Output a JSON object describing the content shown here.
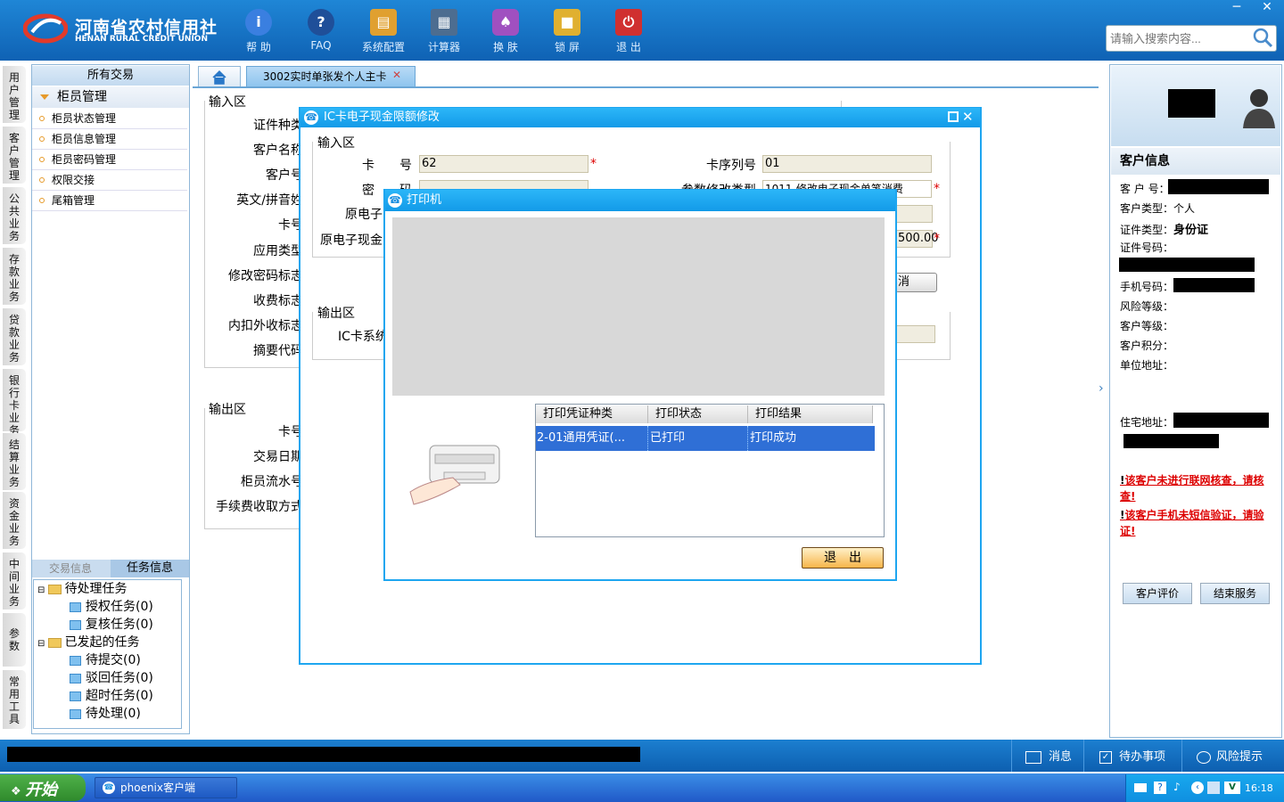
{
  "brand": {
    "name_cn": "河南省农村信用社",
    "name_en": "HENAN RURAL CREDIT UNION"
  },
  "toolbar": [
    {
      "label": "帮 助",
      "icon": "info-icon",
      "color": "#3a7fe0"
    },
    {
      "label": "FAQ",
      "icon": "question-icon",
      "color": "#1f4f99"
    },
    {
      "label": "系统配置",
      "icon": "toolbox-icon",
      "color": "#e0a030"
    },
    {
      "label": "计算器",
      "icon": "calculator-icon",
      "color": "#4d6d90"
    },
    {
      "label": "换 肤",
      "icon": "tshirt-icon",
      "color": "#a050c0"
    },
    {
      "label": "锁 屏",
      "icon": "lock-icon",
      "color": "#e0b030"
    },
    {
      "label": "退 出",
      "icon": "power-icon",
      "color": "#d03030"
    }
  ],
  "search": {
    "placeholder": "请输入搜索内容..."
  },
  "vnav": [
    "用户管理",
    "客户管理",
    "公共业务",
    "存款业务",
    "贷款业务",
    "银行卡业务",
    "结算业务",
    "资金业务",
    "中间业务",
    "参数",
    "常用工具"
  ],
  "left": {
    "header": "所有交易",
    "group": "柜员管理",
    "items": [
      "柜员状态管理",
      "柜员信息管理",
      "柜员密码管理",
      "权限交接",
      "尾箱管理"
    ],
    "tabs": [
      "交易信息",
      "任务信息"
    ],
    "tree": {
      "pending": "待处理任务",
      "pending_children": [
        "授权任务(0)",
        "复核任务(0)"
      ],
      "initiated": "已发起的任务",
      "initiated_children": [
        "待提交(0)",
        "驳回任务(0)",
        "超时任务(0)",
        "待处理(0)"
      ]
    }
  },
  "main": {
    "tab": "3002实时单张发个人主卡",
    "input_title": "输入区",
    "output_title": "输出区",
    "labels": [
      "证件种类",
      "客户名称",
      "客户号",
      "英文/拼音姓",
      "卡号",
      "应用类型",
      "修改密码标志",
      "收费标志",
      "内扣外收标志",
      "摘要代码"
    ],
    "out_labels": [
      "卡号",
      "交易日期",
      "柜员流水号",
      "手续费收取方式"
    ]
  },
  "dlg1": {
    "title": "IC卡电子现金限额修改",
    "input_title": "输入区",
    "output_title": "输出区",
    "card_label": "卡　　号",
    "card_value": "62",
    "pwd_label": "密　　码",
    "orig1_label": "原电子",
    "orig2_label": "原电子现金",
    "seq_label": "卡序列号",
    "seq_value": "01",
    "param_label": "参数修改类型",
    "param_value": "1011-修改电子现金单笔消费",
    "amount_value": "500.00",
    "out_label": "IC卡系统",
    "cancel_label": "消"
  },
  "dlg2": {
    "title": "打印机",
    "columns": [
      "打印凭证种类",
      "打印状态",
      "打印结果"
    ],
    "rows": [
      {
        "type": "2-01通用凭证(...",
        "status": "已打印",
        "result": "打印成功"
      }
    ],
    "exit_label": "退出"
  },
  "customer": {
    "title": "客户信息",
    "no_label": "客 户 号：",
    "type_label": "客户类型：",
    "type_value": "个人",
    "idtype_label": "证件类型：",
    "idtype_value": "身份证",
    "idno_label": "证件号码：",
    "phone_label": "手机号码：",
    "risk_label": "风险等级：",
    "level_label": "客户等级：",
    "points_label": "客户积分：",
    "unit_label": "单位地址：",
    "home_label": "住宅地址：",
    "warn1": "该客户未进行联网核查，请核查!",
    "warn2": "该客户手机未短信验证，请验证!",
    "btn_eval": "客户评价",
    "btn_end": "结束服务"
  },
  "status": {
    "msg": "消息",
    "todo": "待办事项",
    "risk": "风险提示"
  },
  "taskbar": {
    "start": "开始",
    "app": "phoenix客户端",
    "clock": "16:18"
  }
}
